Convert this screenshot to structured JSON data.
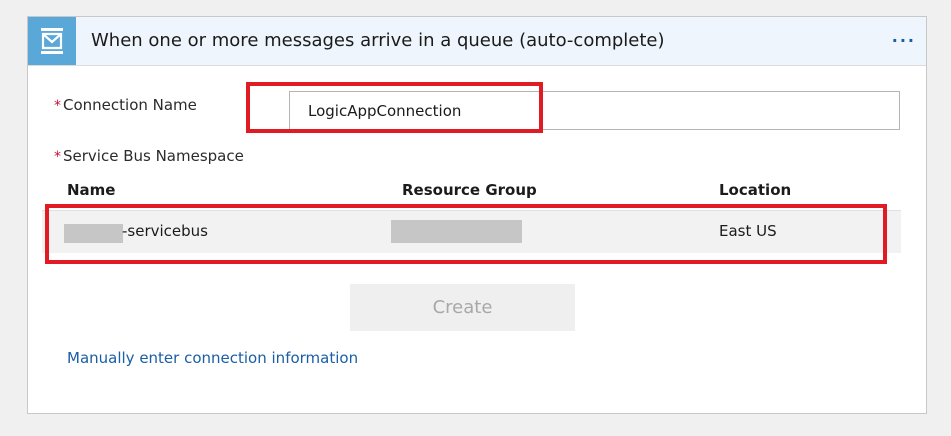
{
  "header": {
    "title": "When one or more messages arrive in a queue (auto-complete)",
    "icon": "service-bus-queue-icon",
    "menu_label": "···",
    "icon_bg": "#59a8d8",
    "header_bg": "#eef5fc"
  },
  "form": {
    "required_mark": "*",
    "connection_name_label": "Connection Name",
    "connection_name_value": "LogicAppConnection",
    "namespace_label": "Service Bus Namespace"
  },
  "table": {
    "columns": [
      "Name",
      "Resource Group",
      "Location"
    ],
    "rows": [
      {
        "name": "-servicebus",
        "resource_group": "",
        "location": "East US"
      }
    ]
  },
  "actions": {
    "create_label": "Create",
    "manual_link": "Manually enter connection information"
  },
  "colors": {
    "highlight": "#e01b24",
    "link": "#1a5ea6",
    "required": "#c8102e"
  }
}
